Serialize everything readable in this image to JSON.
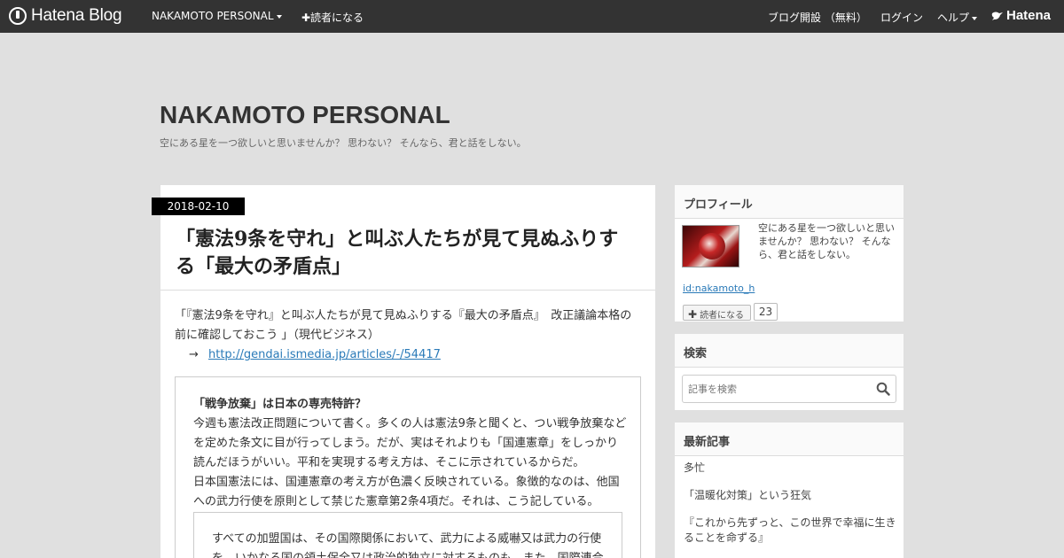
{
  "topbar": {
    "logo_text": "Hatena Blog",
    "blog_menu": "NAKAMOTO PERSONAL",
    "follow_label": "✚読者になる",
    "blog_open": "ブログ開設 （無料）",
    "login": "ログイン",
    "help": "ヘルプ",
    "hatena": "Hatena",
    "bg_color": "#333333"
  },
  "blog": {
    "title": "NAKAMOTO PERSONAL",
    "description": "空にある星を一つ欲しいと思いませんか？ 思わない？ そんなら、君と話をしない。"
  },
  "entry": {
    "date": "2018-02-10",
    "title": "「憲法9条を守れ」と叫ぶ人たちが見て見ぬふりする「最大の矛盾点」",
    "lead_line": "「『憲法9条を守れ』と叫ぶ人たちが見て見ぬふりする『最大の矛盾点』　改正議論本格の前に確認しておこう 」（現代ビジネス）",
    "arrow": "→",
    "link": "http://gendai.ismedia.jp/articles/-/54417",
    "quote_heading": "「戦争放棄」は日本の専売特許？",
    "quote_p1": "今週も憲法改正問題について書く。多くの人は憲法9条と聞くと、つい戦争放棄などを定めた条文に目が行ってしまう。だが、実はそれよりも「国連憲章」をしっかり読んだほうがいい。平和を実現する考え方は、そこに示されているからだ。",
    "quote_p2": "日本国憲法には、国連憲章の考え方が色濃く反映されている。象徴的なのは、他国への武力行使を原則として禁じた憲章第2条4項だ。それは、こう記している。",
    "inner_quote": "すべての加盟国は、その国際関係において、武力による威嚇又は武力の行使を、いかなる国の領土保全又は政治的独立に対するものも、また、国際連合"
  },
  "sidebar": {
    "profile": {
      "heading": "プロフィール",
      "description": "空にある星を一つ欲しいと思いませんか？ 思わない？ そんなら、君と話をしない。",
      "id": "id:nakamoto_h",
      "reader_button": "読者になる",
      "reader_count": "23"
    },
    "search": {
      "heading": "検索",
      "placeholder": "記事を検索"
    },
    "recent": {
      "heading": "最新記事",
      "items": [
        "多忙",
        "「温暖化対策」という狂気",
        "『これから先ずっと、この世界で幸福に生きることを命ずる』"
      ]
    }
  }
}
